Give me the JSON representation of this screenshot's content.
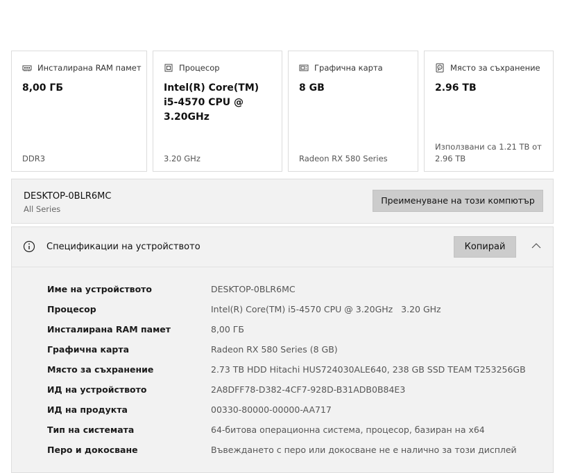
{
  "cards": [
    {
      "icon": "ram-icon",
      "title": "Инсталирана RAM памет",
      "value": "8,00 ГБ",
      "footer": "DDR3"
    },
    {
      "icon": "processor-icon",
      "title": "Процесор",
      "value": "Intel(R) Core(TM) i5-4570 CPU @ 3.20GHz",
      "footer": "3.20 GHz"
    },
    {
      "icon": "graphics-card-icon",
      "title": "Графична карта",
      "value": "8 GB",
      "footer": "Radeon RX 580 Series"
    },
    {
      "icon": "storage-icon",
      "title": "Място за съхранение",
      "value": "2.96 TB",
      "footer": "Използвани са 1.21 TB от 2.96 TB"
    }
  ],
  "computer": {
    "name": "DESKTOP-0BLR6MC",
    "model": "All Series",
    "rename_label": "Преименуване на този компютър"
  },
  "specs": {
    "title": "Спецификации на устройството",
    "copy_label": "Копирай",
    "rows": [
      {
        "label": "Име на устройството",
        "value": "DESKTOP-0BLR6MC"
      },
      {
        "label": "Процесор",
        "value": "Intel(R) Core(TM) i5-4570 CPU @ 3.20GHz   3.20 GHz"
      },
      {
        "label": "Инсталирана RAM памет",
        "value": "8,00 ГБ"
      },
      {
        "label": "Графична карта",
        "value": "Radeon RX 580 Series (8 GB)"
      },
      {
        "label": "Място за съхранение",
        "value": "2.73 TB HDD Hitachi HUS724030ALE640, 238 GB SSD TEAM T253256GB"
      },
      {
        "label": "ИД на устройството",
        "value": "2A8DFF78-D382-4CF7-928D-B31ADB0B84E3"
      },
      {
        "label": "ИД на продукта",
        "value": "00330-80000-00000-AA717"
      },
      {
        "label": "Тип на системата",
        "value": "64-битова операционна система, процесор, базиран на x64"
      },
      {
        "label": "Перо и докосване",
        "value": "Въвеждането с перо или докосване не е налично за този дисплей"
      }
    ]
  }
}
